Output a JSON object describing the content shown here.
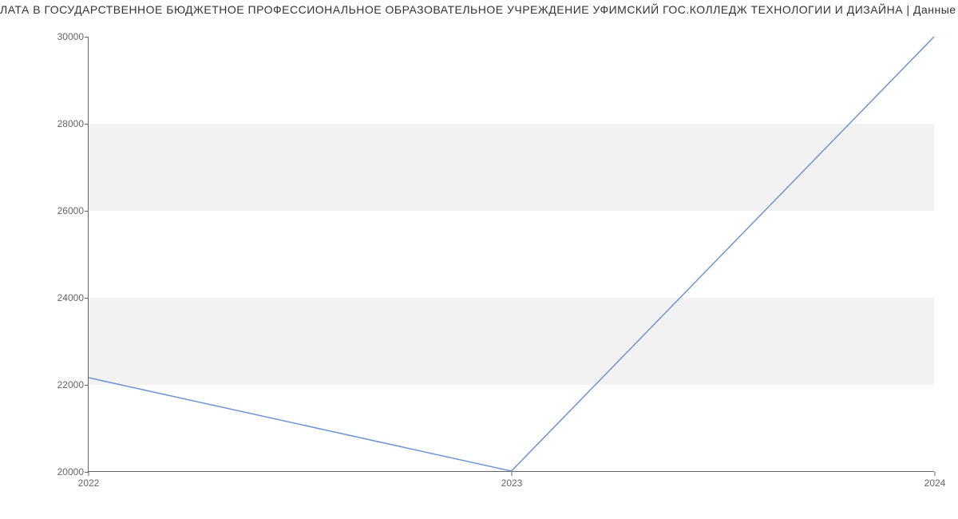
{
  "title": "ЛАТА В ГОСУДАРСТВЕННОЕ БЮДЖЕТНОЕ ПРОФЕССИОНАЛЬНОЕ ОБРАЗОВАТЕЛЬНОЕ УЧРЕЖДЕНИЕ УФИМСКИЙ ГОС.КОЛЛЕДЖ ТЕХНОЛОГИИ И ДИЗАЙНА | Данные mnogo.",
  "chart_data": {
    "type": "line",
    "x": [
      2022,
      2023,
      2024
    ],
    "values": [
      22150,
      20000,
      30000
    ],
    "xlabel": "",
    "ylabel": "",
    "x_ticks": [
      2022,
      2023,
      2024
    ],
    "y_ticks": [
      20000,
      22000,
      24000,
      26000,
      28000,
      30000
    ],
    "xlim": [
      2022,
      2024
    ],
    "ylim": [
      20000,
      30000
    ],
    "bands": [
      {
        "from": 22000,
        "to": 24000
      },
      {
        "from": 26000,
        "to": 28000
      }
    ],
    "line_color": "#6f94d1"
  }
}
